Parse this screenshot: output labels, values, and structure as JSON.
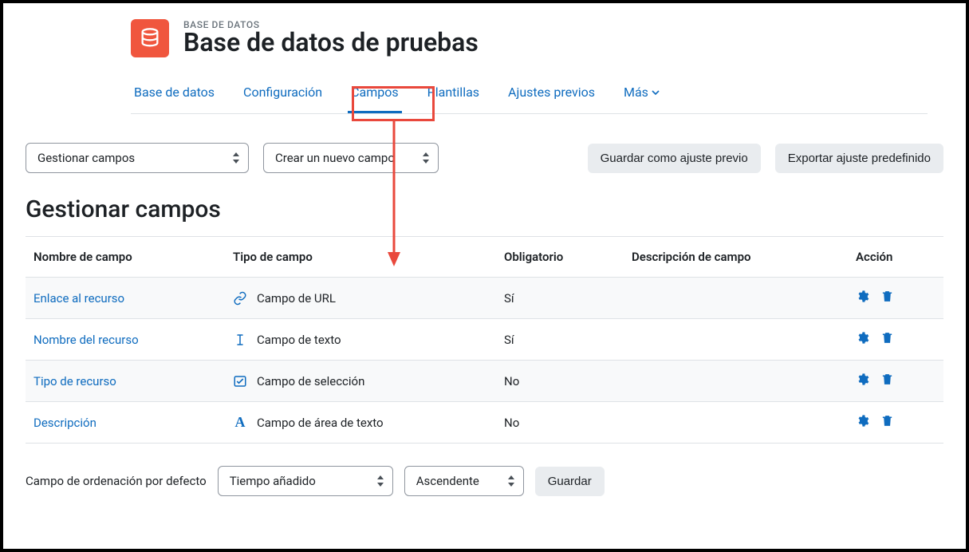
{
  "header": {
    "breadcrumb": "BASE DE DATOS",
    "title": "Base de datos de pruebas"
  },
  "tabs": [
    {
      "label": "Base de datos"
    },
    {
      "label": "Configuración"
    },
    {
      "label": "Campos"
    },
    {
      "label": "Plantillas"
    },
    {
      "label": "Ajustes previos"
    },
    {
      "label": "Más"
    }
  ],
  "controls": {
    "manage_select": "Gestionar campos",
    "create_select": "Crear un nuevo campo",
    "save_preset_btn": "Guardar como ajuste previo",
    "export_preset_btn": "Exportar ajuste predefinido"
  },
  "section_title": "Gestionar campos",
  "table": {
    "headers": {
      "name": "Nombre de campo",
      "type": "Tipo de campo",
      "required": "Obligatorio",
      "desc": "Descripción de campo",
      "action": "Acción"
    },
    "rows": [
      {
        "name": "Enlace al recurso",
        "type": "Campo de URL",
        "required": "Sí",
        "desc": "",
        "icon": "url"
      },
      {
        "name": "Nombre del recurso",
        "type": "Campo de texto",
        "required": "Sí",
        "desc": "",
        "icon": "text"
      },
      {
        "name": "Tipo de recurso",
        "type": "Campo de selección",
        "required": "No",
        "desc": "",
        "icon": "select"
      },
      {
        "name": "Descripción",
        "type": "Campo de área de texto",
        "required": "No",
        "desc": "",
        "icon": "textarea"
      }
    ]
  },
  "sort": {
    "label": "Campo de ordenación por defecto",
    "field_select": "Tiempo añadido",
    "dir_select": "Ascendente",
    "save_btn": "Guardar"
  }
}
